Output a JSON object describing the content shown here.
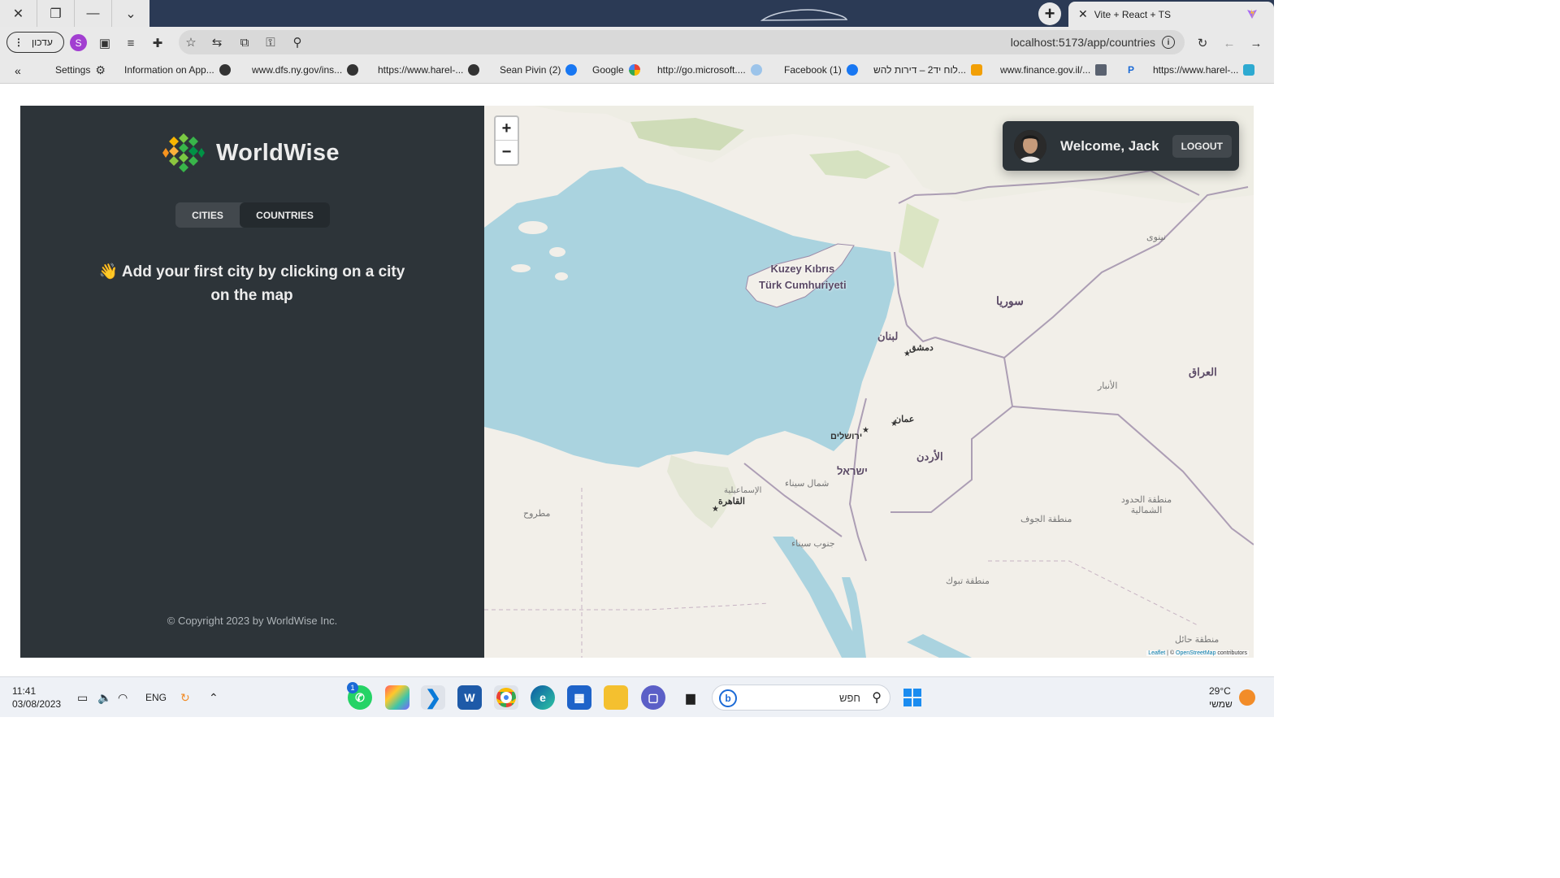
{
  "browser": {
    "window_controls": [
      "close",
      "restore",
      "minimize",
      "tab-list"
    ],
    "tab": {
      "title": "Vite + React + TS"
    },
    "update_button_label": "עדכון",
    "profile_initial": "S",
    "url": "localhost:5173/app/countries",
    "bookmarks": [
      {
        "label": "Settings"
      },
      {
        "label": "Information on App..."
      },
      {
        "label": "www.dfs.ny.gov/ins..."
      },
      {
        "label": "https://www.harel-..."
      },
      {
        "label": "Sean Pivin (2)"
      },
      {
        "label": "Google"
      },
      {
        "label": "http://go.microsoft...."
      },
      {
        "label": "Facebook (1)"
      },
      {
        "label": "לוח יד2 – דירות להש..."
      },
      {
        "label": "www.finance.gov.il/..."
      },
      {
        "label": "https://www.harel-..."
      }
    ],
    "bookmarks_chevron": "«"
  },
  "app": {
    "logo_text": "WorldWise",
    "tabs": [
      {
        "label": "CITIES",
        "active": false
      },
      {
        "label": "COUNTRIES",
        "active": true
      }
    ],
    "message": "👋 Add your first city by clicking on a city on the map",
    "copyright": "© Copyright 2023 by WorldWise Inc."
  },
  "map": {
    "zoom_in": "+",
    "zoom_out": "−",
    "labels": {
      "cyprus_line1": "Kuzey Kıbrıs",
      "cyprus_line2": "Türk Cumhuriyeti",
      "syria": "سوريا",
      "lebanon": "لبنان",
      "damascus": "دمشق",
      "amman": "عمان",
      "jerusalem": "ירושלים",
      "jordan": "الأردن",
      "israel": "ישראל",
      "iraq": "العراق",
      "cairo": "القاهرة",
      "north_sinai": "شمال سيناء",
      "south_sinai": "جنوب سيناء",
      "matrouh": "مطروح",
      "tabuk": "منطقة تبوك",
      "jawf": "منطقة الجوف",
      "northern_borders": "منطقة الحدود الشمالية",
      "hail": "منطقة حائل",
      "nineveh": "نينوى",
      "ismailia": "الإسماعيلية",
      "anbar": "الأنبار"
    },
    "attribution_leaflet": "Leaflet",
    "attribution_sep": " | © ",
    "attribution_osm": "OpenStreetMap",
    "attribution_rest": " contributors",
    "colors": {
      "sea": "#aad3df",
      "land": "#f2efe9",
      "border": "#9b8aa8"
    }
  },
  "user": {
    "welcome": "Welcome, Jack",
    "logout_label": "LOGOUT"
  },
  "taskbar": {
    "time": "11:41",
    "date": "03/08/2023",
    "lang": "ENG",
    "search_placeholder": "חפש",
    "weather_temp": "29°C",
    "weather_desc": "שמשי",
    "whatsapp_badge": "1"
  }
}
